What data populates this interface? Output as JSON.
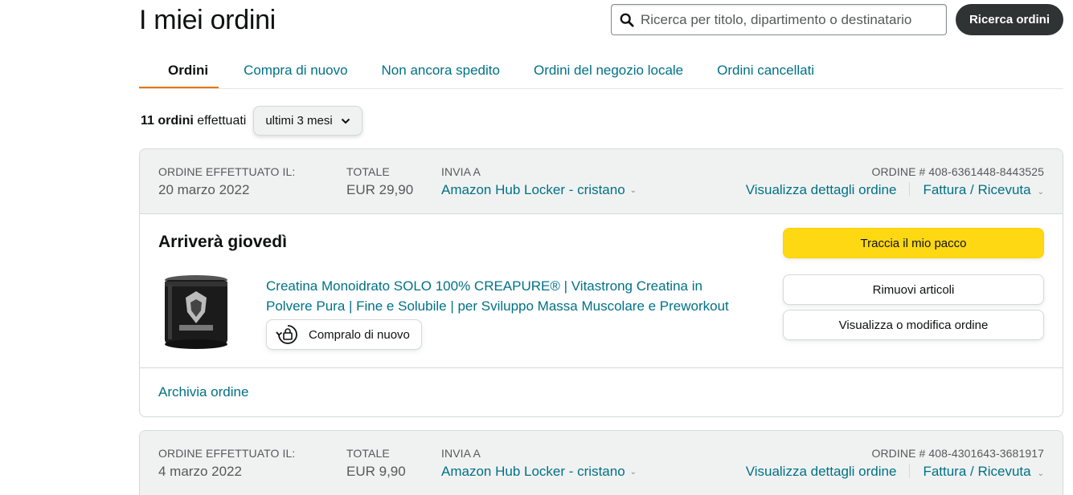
{
  "header": {
    "title": "I miei ordini",
    "search_placeholder": "Ricerca per titolo, dipartimento o destinatario",
    "search_button": "Ricerca ordini"
  },
  "tabs": [
    {
      "label": "Ordini",
      "active": true
    },
    {
      "label": "Compra di nuovo",
      "active": false
    },
    {
      "label": "Non ancora spedito",
      "active": false
    },
    {
      "label": "Ordini del negozio locale",
      "active": false
    },
    {
      "label": "Ordini cancellati",
      "active": false
    }
  ],
  "summary": {
    "count": "11 ordini",
    "suffix": "effettuati",
    "period": "ultimi 3 mesi"
  },
  "labels": {
    "placed": "ORDINE EFFETTUATO IL:",
    "total": "TOTALE",
    "ship_to": "INVIA A",
    "details": "Visualizza dettagli ordine",
    "invoice": "Fattura / Ricevuta"
  },
  "orders": [
    {
      "date": "20 marzo 2022",
      "total": "EUR 29,90",
      "ship_to": "Amazon Hub Locker - cristano",
      "order_number": "ORDINE # 408-6361448-8443525",
      "delivery_status": "Arriverà giovedì",
      "product_title": "Creatina Monoidrato SOLO 100% CREAPURE® | Vitastrong Creatina in Polvere Pura | Fine e Solubile | per Sviluppo Massa Muscolare e Preworkout",
      "buy_again": "Compralo di nuovo",
      "track_button": "Traccia il mio pacco",
      "remove_button": "Rimuovi articoli",
      "edit_button": "Visualizza o modifica ordine",
      "archive": "Archivia ordine"
    },
    {
      "date": "4 marzo 2022",
      "total": "EUR 9,90",
      "ship_to": "Amazon Hub Locker - cristano",
      "order_number": "ORDINE # 408-4301643-3681917"
    }
  ],
  "colors": {
    "link": "#007185",
    "primary_button": "#ffd814",
    "active_tab_underline": "#e77600",
    "search_button": "#303333"
  }
}
